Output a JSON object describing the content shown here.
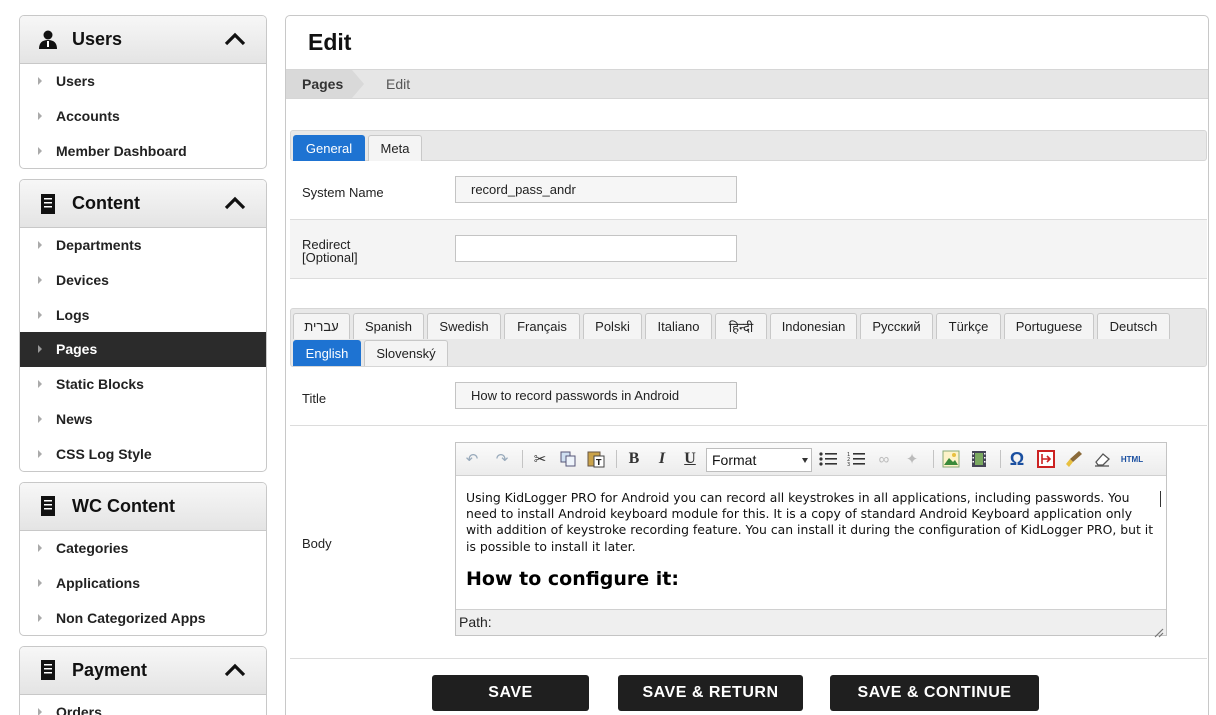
{
  "sidebar": {
    "users": {
      "title": "Users",
      "icon": "user-icon",
      "items": [
        {
          "label": "Users"
        },
        {
          "label": "Accounts"
        },
        {
          "label": "Member Dashboard"
        }
      ]
    },
    "content": {
      "title": "Content",
      "icon": "document-icon",
      "items": [
        {
          "label": "Departments"
        },
        {
          "label": "Devices"
        },
        {
          "label": "Logs"
        },
        {
          "label": "Pages",
          "active": true
        },
        {
          "label": "Static Blocks"
        },
        {
          "label": "News"
        },
        {
          "label": "CSS Log Style"
        }
      ]
    },
    "wc_content": {
      "title": "WC Content",
      "icon": "document-icon",
      "items": [
        {
          "label": "Categories"
        },
        {
          "label": "Applications"
        },
        {
          "label": "Non Categorized Apps"
        }
      ]
    },
    "payment": {
      "title": "Payment",
      "icon": "document-icon",
      "items": [
        {
          "label": "Orders"
        }
      ]
    }
  },
  "main": {
    "title": "Edit",
    "breadcrumb": [
      "Pages",
      "Edit"
    ],
    "top_tabs": [
      {
        "label": "General",
        "active": true
      },
      {
        "label": "Meta",
        "active": false
      }
    ],
    "fields": {
      "system_name": {
        "label": "System Name",
        "value": "record_pass_andr"
      },
      "redirect": {
        "label_line1": "Redirect",
        "label_line2": "[Optional]",
        "value": ""
      },
      "title": {
        "label": "Title",
        "value": "How to record passwords in Android"
      },
      "body": {
        "label": "Body"
      }
    },
    "language_tabs_row1": [
      "עברית",
      "Spanish",
      "Swedish",
      "Français",
      "Polski",
      "Italiano",
      "हिन्दी",
      "Indonesian",
      "Русский",
      "Türkçe",
      "Portuguese",
      "Deutsch"
    ],
    "language_tabs_row2": [
      {
        "label": "English",
        "active": true
      },
      {
        "label": "Slovenský",
        "active": false
      }
    ],
    "editor": {
      "format_label": "Format",
      "html_label": "HTML",
      "body_text": "Using KidLogger PRO for Android you can record all keystrokes in all applications, including passwords. You need to install Android keyboard module for this. It is a copy of standard Android Keyboard application only with addition of keystroke recording feature. You can install it during the configuration of KidLogger PRO, but it is possible to install it later.",
      "heading": "How to configure it:",
      "path_label": "Path:"
    },
    "buttons": {
      "save": "SAVE",
      "save_return": "SAVE & RETURN",
      "save_continue": "SAVE & CONTINUE"
    }
  },
  "colors": {
    "active_tab": "#1e73d2",
    "sidebar_active": "#2b2b2b",
    "button_bg": "#1f1f1f"
  }
}
